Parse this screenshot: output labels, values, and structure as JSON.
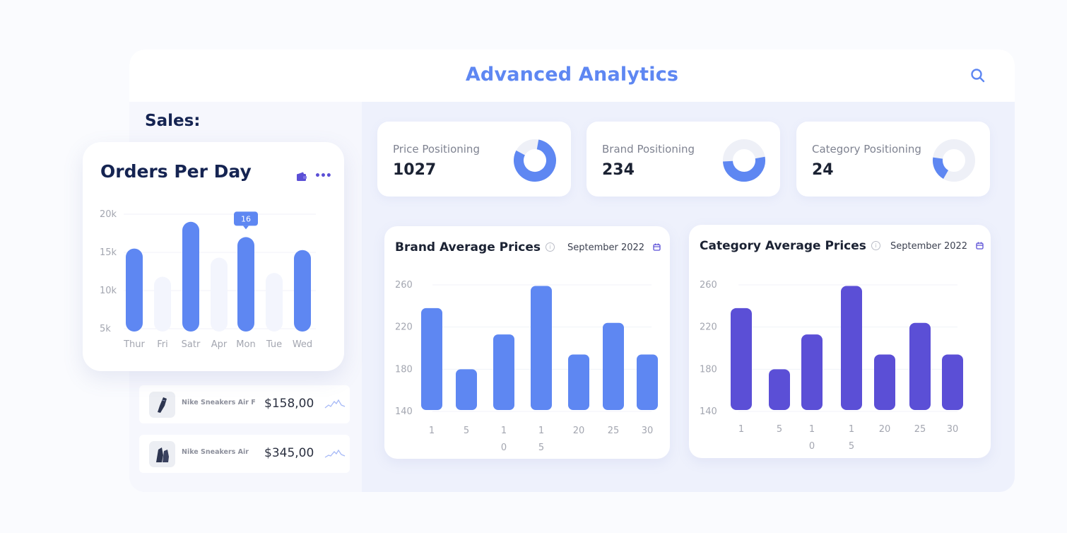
{
  "header": {
    "title": "Advanced Analytics",
    "search_icon": "search-icon"
  },
  "sales": {
    "label": "Sales:",
    "orders_card": {
      "title": "Orders Per Day",
      "wallet_icon": "wallet-icon",
      "more_icon": "more-icon",
      "more_label": "•••",
      "tooltip": "16",
      "tooltip_index": 4
    },
    "products": [
      {
        "name": "Nike Sneakers Air F",
        "price": "$158,00",
        "icon": "sneaker-icon"
      },
      {
        "name": "Nike Sneakers Air",
        "price": "$345,00",
        "icon": "sneaker-pair-icon"
      }
    ]
  },
  "kpis": [
    {
      "label": "Price Positioning",
      "value": "1027",
      "fraction": 0.8,
      "start_deg": 10
    },
    {
      "label": "Brand Positioning",
      "value": "234",
      "fraction": 0.52,
      "start_deg": 80
    },
    {
      "label": "Category Positioning",
      "value": "24",
      "fraction": 0.19,
      "start_deg": 210
    }
  ],
  "colors": {
    "accent": "#5e87f2",
    "purple": "#5b4fd6",
    "light_bar": "#f3f5fd",
    "navy": "#152452",
    "track": "#eef0f7"
  },
  "chart_data": [
    {
      "type": "bar",
      "title": "Orders Per Day",
      "categories": [
        "Thur",
        "Fri",
        "Satr",
        "Apr",
        "Mon",
        "Tue",
        "Wed"
      ],
      "values": [
        15.5,
        11.8,
        19,
        14.3,
        17,
        12.3,
        15.3
      ],
      "highlighted": [
        true,
        false,
        true,
        false,
        true,
        false,
        true
      ],
      "yticks": [
        "20k",
        "15k",
        "10k",
        "5k"
      ],
      "ytick_values": [
        20,
        15,
        10,
        5
      ],
      "ylim": [
        5,
        20
      ],
      "unit": "k",
      "grid": true,
      "annotation": {
        "category": "Mon",
        "text": "16"
      }
    },
    {
      "type": "bar",
      "title": "Brand Average Prices",
      "period": "September 2022",
      "categories": [
        "1",
        "5",
        "10",
        "15",
        "20",
        "25",
        "30"
      ],
      "values": [
        238,
        180,
        213,
        259,
        194,
        224,
        194
      ],
      "yticks": [
        "260",
        "220",
        "180",
        "140"
      ],
      "ytick_values": [
        260,
        220,
        180,
        140
      ],
      "ylim": [
        140,
        260
      ],
      "grid": true,
      "color": "#5e87f2"
    },
    {
      "type": "bar",
      "title": "Category Average Prices",
      "period": "September 2022",
      "categories": [
        "1",
        "5",
        "10",
        "15",
        "20",
        "25",
        "30"
      ],
      "values": [
        238,
        180,
        213,
        259,
        194,
        224,
        194
      ],
      "yticks": [
        "260",
        "220",
        "180",
        "140"
      ],
      "ytick_values": [
        260,
        220,
        180,
        140
      ],
      "ylim": [
        140,
        260
      ],
      "grid": true,
      "color": "#5b4fd6"
    }
  ]
}
